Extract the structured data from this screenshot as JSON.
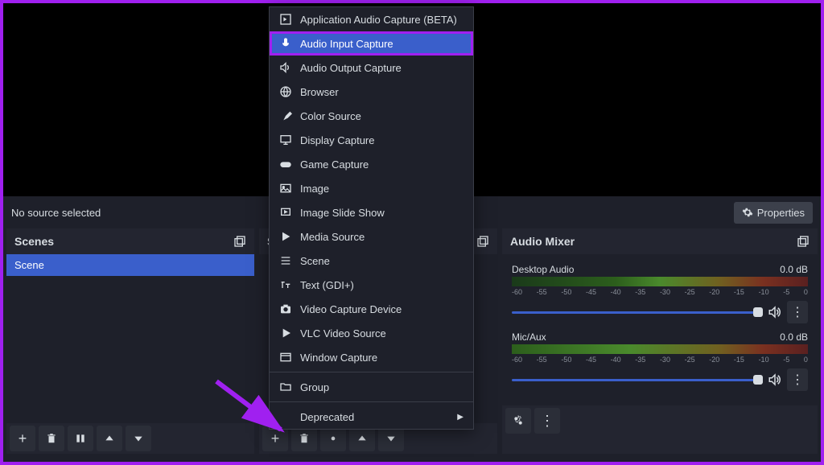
{
  "no_source": "No source selected",
  "properties_btn": "Properties",
  "panels": {
    "scenes_title": "Scenes",
    "sources_title": "Sources",
    "mixer_title": "Audio Mixer",
    "scene_item": "Scene"
  },
  "mixer": {
    "desktop_label": "Desktop Audio",
    "desktop_db": "0.0 dB",
    "mic_label": "Mic/Aux",
    "mic_db": "0.0 dB",
    "scale": [
      "-60",
      "-55",
      "-50",
      "-45",
      "-40",
      "-35",
      "-30",
      "-25",
      "-20",
      "-15",
      "-10",
      "-5",
      "0"
    ]
  },
  "menu": {
    "items": [
      {
        "label": "Application Audio Capture (BETA)",
        "icon": "app-audio"
      },
      {
        "label": "Audio Input Capture",
        "icon": "mic",
        "selected": true
      },
      {
        "label": "Audio Output Capture",
        "icon": "speaker"
      },
      {
        "label": "Browser",
        "icon": "globe"
      },
      {
        "label": "Color Source",
        "icon": "brush"
      },
      {
        "label": "Display Capture",
        "icon": "display"
      },
      {
        "label": "Game Capture",
        "icon": "gamepad"
      },
      {
        "label": "Image",
        "icon": "image"
      },
      {
        "label": "Image Slide Show",
        "icon": "slideshow"
      },
      {
        "label": "Media Source",
        "icon": "play"
      },
      {
        "label": "Scene",
        "icon": "scene"
      },
      {
        "label": "Text (GDI+)",
        "icon": "text"
      },
      {
        "label": "Video Capture Device",
        "icon": "camera"
      },
      {
        "label": "VLC Video Source",
        "icon": "vlc"
      },
      {
        "label": "Window Capture",
        "icon": "window"
      }
    ],
    "group": "Group",
    "deprecated": "Deprecated"
  }
}
